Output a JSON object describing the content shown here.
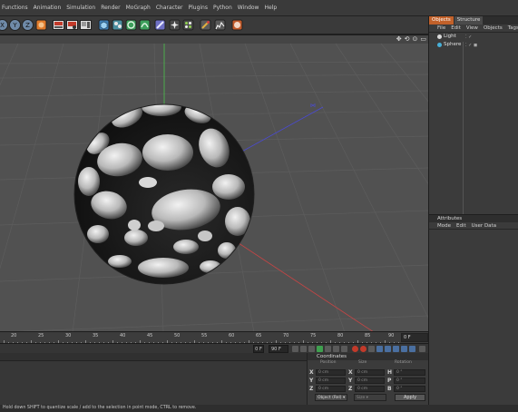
{
  "menu": [
    "Functions",
    "Animation",
    "Simulation",
    "Render",
    "MoGraph",
    "Character",
    "Plugins",
    "Python",
    "Window",
    "Help"
  ],
  "toolbar": {
    "icons": [
      "x-axis-lock-icon",
      "y-axis-lock-icon",
      "z-axis-lock-icon",
      "world-coordinates-icon",
      "render-view-icon",
      "render-picture-viewer-icon",
      "edit-render-settings-icon",
      "cube-primitive-icon",
      "subdivision-icon",
      "array-icon",
      "deformer-icon",
      "scene-icon",
      "camera-icon",
      "light-icon",
      "effector-icon",
      "sketch-icon",
      "python-icon"
    ]
  },
  "viewport": {
    "nav_icons": [
      "✥",
      "⟲",
      "⊙",
      "▭"
    ],
    "colors": {
      "background": "#515151",
      "grid": "#5b5b5b",
      "y_axis": "#4cc24c",
      "x_axis": "#c64545",
      "z_axis": "#4a4ad6"
    }
  },
  "timeline": {
    "labels": [
      "20",
      "25",
      "30",
      "35",
      "40",
      "45",
      "50",
      "55",
      "60",
      "65",
      "70",
      "75",
      "80",
      "85",
      "90"
    ],
    "frame_readout": "0 F"
  },
  "playback": {
    "current_frame": "0 F",
    "field_value": "90 F"
  },
  "coordinates": {
    "title": "Coordinates",
    "columns": [
      "Position",
      "Size",
      "Rotation"
    ],
    "rows": [
      {
        "axis": "X",
        "pos": "0 cm",
        "size_axis": "X",
        "size": "0 cm",
        "rot_axis": "H",
        "rot": "0 °"
      },
      {
        "axis": "Y",
        "pos": "0 cm",
        "size_axis": "Y",
        "size": "0 cm",
        "rot_axis": "P",
        "rot": "0 °"
      },
      {
        "axis": "Z",
        "pos": "0 cm",
        "size_axis": "Z",
        "size": "0 cm",
        "rot_axis": "B",
        "rot": "0 °"
      }
    ],
    "object_mode": "Object (Rel) ▾",
    "size_mode": "Size ▾",
    "apply_label": "Apply"
  },
  "status_text": "Hold down SHIFT to quantize scale / add to the selection in point mode, CTRL to remove.",
  "objects_panel": {
    "tabs": [
      "Objects",
      "Structure"
    ],
    "menu": [
      "File",
      "Edit",
      "View",
      "Objects",
      "Tags"
    ],
    "items": [
      {
        "name": "Light",
        "icon": "light-icon",
        "color": "#d9d9d9"
      },
      {
        "name": "Sphere",
        "icon": "sphere-icon",
        "color": "#48b0d8"
      }
    ]
  },
  "attributes_panel": {
    "title": "Attributes",
    "menu": [
      "Mode",
      "Edit",
      "User Data"
    ]
  }
}
